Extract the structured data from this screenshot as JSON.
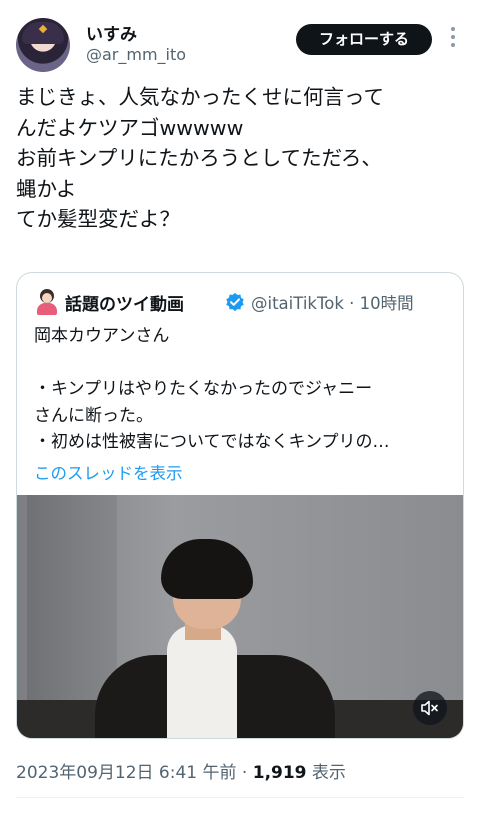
{
  "author": {
    "display_name": "いすみ",
    "handle": "@ar_mm_ito",
    "follow_label": "フォローする",
    "avatar_icon": "anime-character-avatar"
  },
  "tweet": {
    "lines": [
      "まじきょ、人気なかったくせに何言って",
      "んだよケツアゴwwwww",
      "お前キンプリにたかろうとしてただろ、",
      "蝿かよ",
      "てか髪型変だよ？"
    ]
  },
  "quoted": {
    "name": "話題のツイ動画",
    "handle": "@itaiTikTok",
    "separator": "·",
    "time": "10時間",
    "body_lines": [
      "岡本カウアンさん",
      "",
      "・キンプリはやりたくなかったのでジャニー",
      "さんに断った。",
      "・初めは性被害についてではなくキンプリの…"
    ],
    "thread_link": "このスレッドを表示",
    "verified_color": "#1d9bf0"
  },
  "video": {
    "mute_icon": "speaker-muted-icon"
  },
  "meta": {
    "date": "2023年09月12日 6:41 午前",
    "separator": "·",
    "views_count": "1,919",
    "views_label": "表示"
  },
  "colors": {
    "text": "#0f1419",
    "secondary": "#536471",
    "link": "#1d9bf0",
    "border": "#cfd9de"
  }
}
